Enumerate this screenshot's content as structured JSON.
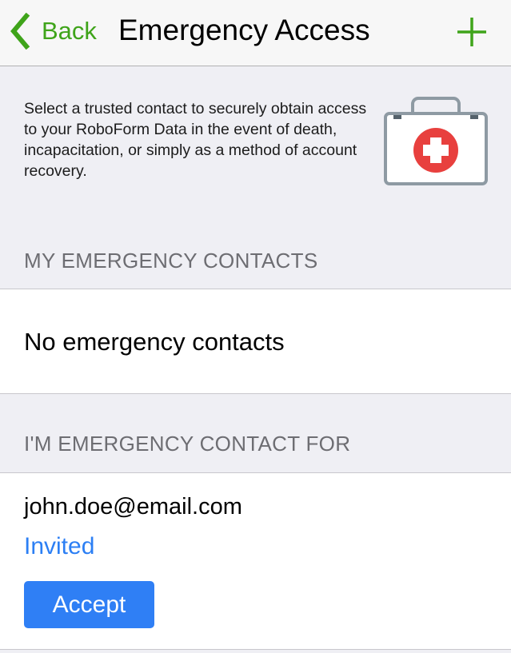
{
  "navbar": {
    "back_label": "Back",
    "title": "Emergency Access"
  },
  "intro": {
    "text": "Select a trusted contact to securely obtain access to your RoboForm Data in the event of death, incapacitation, or simply as a method of account recovery."
  },
  "my_contacts": {
    "header": "MY EMERGENCY CONTACTS",
    "empty_text": "No emergency contacts"
  },
  "contact_for": {
    "header": "I'M EMERGENCY CONTACT FOR",
    "items": [
      {
        "email": "john.doe@email.com",
        "status": "Invited",
        "accept_label": "Accept"
      }
    ]
  },
  "icons": {
    "back": "chevron-left-icon",
    "add": "plus-icon",
    "kit": "first-aid-kit-icon"
  },
  "colors": {
    "accent_green": "#3fa41a",
    "link_blue": "#2c7ff4",
    "button_blue": "#2f7ff5",
    "kit_red": "#e8403e",
    "background": "#efeff4"
  }
}
